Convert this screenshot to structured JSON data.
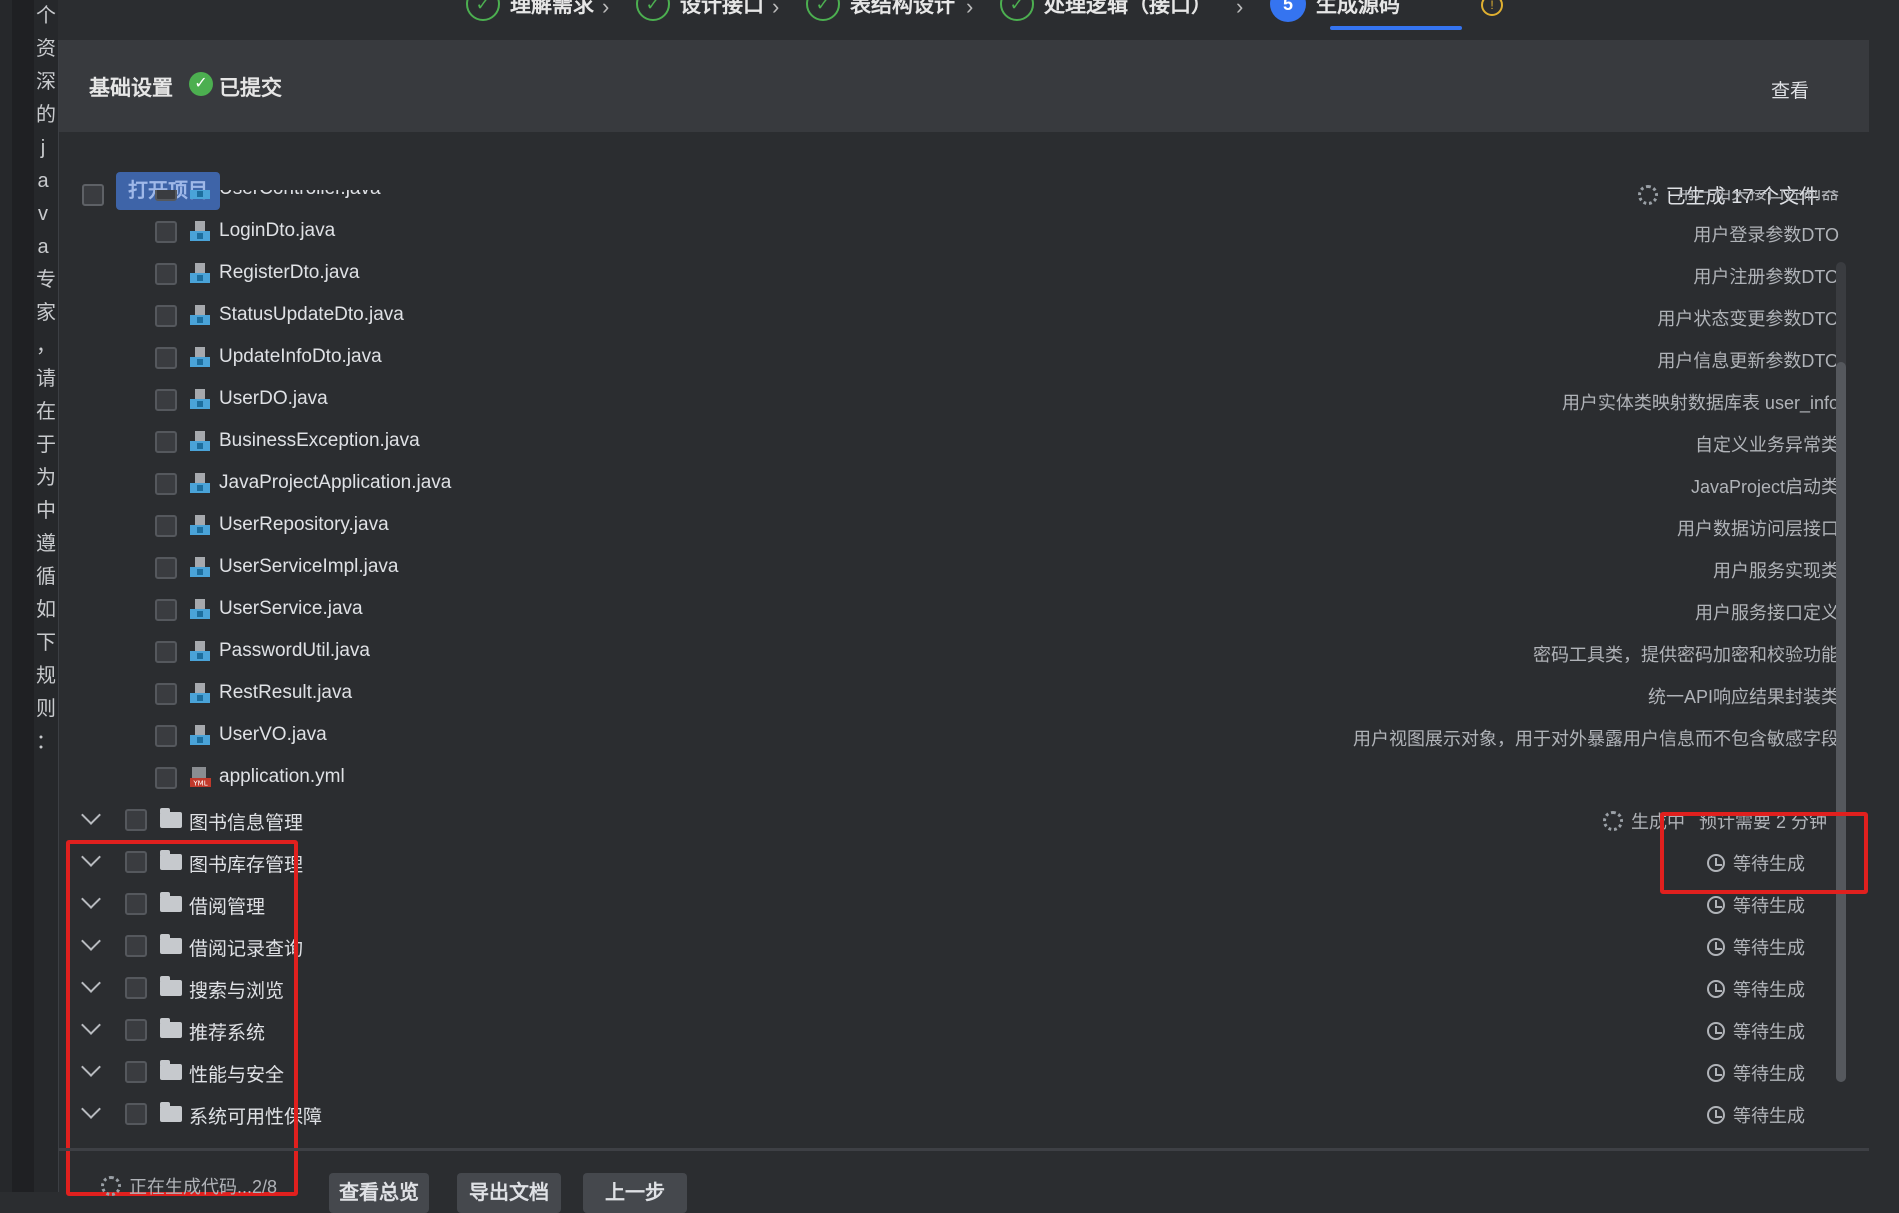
{
  "left_strip": {
    "chars": [
      "个",
      "资",
      "深",
      "的",
      "j",
      "a",
      "v",
      "a",
      "专",
      "家",
      "，",
      "请",
      "在",
      "于",
      "为",
      "中",
      "遵",
      "循",
      "如",
      "下",
      "规",
      "则",
      "："
    ]
  },
  "steps": [
    {
      "label": "理解需求",
      "state": "done"
    },
    {
      "label": "设计接口",
      "state": "done"
    },
    {
      "label": "表结构设计",
      "state": "done"
    },
    {
      "label": "处理逻辑（接口）",
      "state": "done"
    },
    {
      "label": "生成源码",
      "state": "active",
      "number": "5"
    }
  ],
  "header": {
    "title": "基础设置",
    "submitted": "已提交",
    "view": "查看"
  },
  "toolbar": {
    "open_project": "打开项目",
    "generated": "已生成 17 个文件"
  },
  "files": [
    {
      "name": "UserController.java",
      "desc": "用户相关接口控制器",
      "icon": "java-class-icon"
    },
    {
      "name": "LoginDto.java",
      "desc": "用户登录参数DTO",
      "icon": "java-class-icon"
    },
    {
      "name": "RegisterDto.java",
      "desc": "用户注册参数DTO",
      "icon": "java-class-icon"
    },
    {
      "name": "StatusUpdateDto.java",
      "desc": "用户状态变更参数DTO",
      "icon": "java-class-icon"
    },
    {
      "name": "UpdateInfoDto.java",
      "desc": "用户信息更新参数DTO",
      "icon": "java-class-icon"
    },
    {
      "name": "UserDO.java",
      "desc": "用户实体类映射数据库表 user_info",
      "icon": "java-class-icon"
    },
    {
      "name": "BusinessException.java",
      "desc": "自定义业务异常类",
      "icon": "java-class-icon"
    },
    {
      "name": "JavaProjectApplication.java",
      "desc": "JavaProject启动类",
      "icon": "java-class-icon"
    },
    {
      "name": "UserRepository.java",
      "desc": "用户数据访问层接口",
      "icon": "java-class-icon"
    },
    {
      "name": "UserServiceImpl.java",
      "desc": "用户服务实现类",
      "icon": "java-class-icon"
    },
    {
      "name": "UserService.java",
      "desc": "用户服务接口定义",
      "icon": "java-class-icon"
    },
    {
      "name": "PasswordUtil.java",
      "desc": "密码工具类，提供密码加密和校验功能",
      "icon": "java-class-icon"
    },
    {
      "name": "RestResult.java",
      "desc": "统一API响应结果封装类",
      "icon": "java-class-icon"
    },
    {
      "name": "UserVO.java",
      "desc": "用户视图展示对象，用于对外暴露用户信息而不包含敏感字段",
      "icon": "java-class-icon"
    },
    {
      "name": "application.yml",
      "desc": "",
      "icon": "yml-file-icon"
    }
  ],
  "modules": [
    {
      "name": "图书信息管理",
      "status": "生成中",
      "eta": "预计需要 2 分钟",
      "state": "generating"
    },
    {
      "name": "图书库存管理",
      "status": "等待生成",
      "state": "waiting"
    },
    {
      "name": "借阅管理",
      "status": "等待生成",
      "state": "waiting"
    },
    {
      "name": "借阅记录查询",
      "status": "等待生成",
      "state": "waiting"
    },
    {
      "name": "搜索与浏览",
      "status": "等待生成",
      "state": "waiting"
    },
    {
      "name": "推荐系统",
      "status": "等待生成",
      "state": "waiting"
    },
    {
      "name": "性能与安全",
      "status": "等待生成",
      "state": "waiting"
    },
    {
      "name": "系统可用性保障",
      "status": "等待生成",
      "state": "waiting"
    }
  ],
  "footer": {
    "status": "正在生成代码...2/8",
    "buttons": [
      "查看总览",
      "导出文档",
      "上一步"
    ]
  },
  "colors": {
    "accent": "#3574f0",
    "success": "#4caf50",
    "highlight": "#e0201e"
  }
}
